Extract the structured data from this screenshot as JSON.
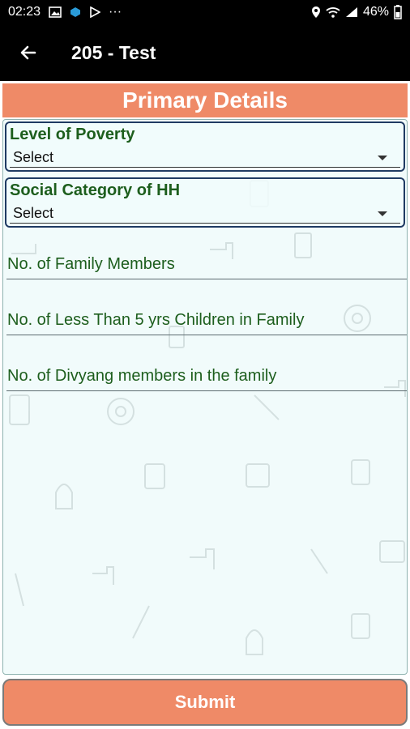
{
  "status_bar": {
    "time": "02:23",
    "battery": "46%",
    "more": "···"
  },
  "app_bar": {
    "title": "205 - Test"
  },
  "header": {
    "title": "Primary Details"
  },
  "form": {
    "level_of_poverty": {
      "label": "Level of Poverty",
      "value": "Select"
    },
    "social_category": {
      "label": "Social Category of HH",
      "value": "Select"
    },
    "family_members": {
      "label": "No. of Family Members"
    },
    "children_under_5": {
      "label": "No. of Less Than 5 yrs Children in Family"
    },
    "divyang_members": {
      "label": "No. of Divyang members in the family"
    }
  },
  "submit": {
    "label": "Submit"
  },
  "colors": {
    "accent": "#ef8a67",
    "label_green": "#1d5e1d",
    "panel_bg": "#f1fbfb",
    "bar_bg": "#000000"
  }
}
